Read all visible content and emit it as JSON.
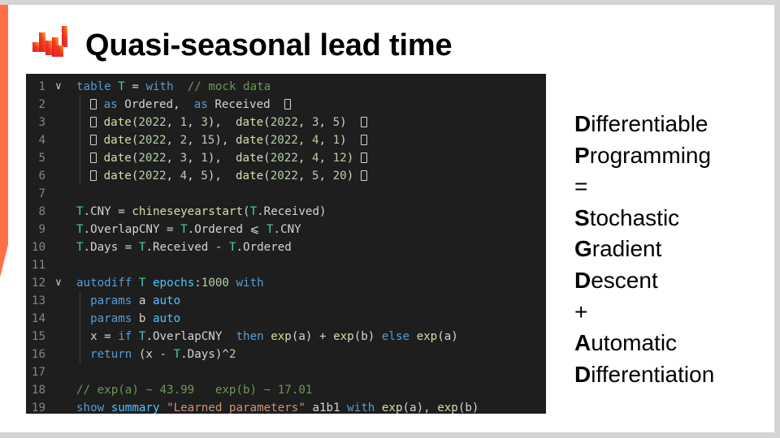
{
  "slide": {
    "title": "Quasi-seasonal lead time",
    "colors": {
      "accent_bar": "#ff7043",
      "logo_gradient": [
        "#d81b2c",
        "#f3391f",
        "#ffa726"
      ],
      "code_background": "#1e1e1e"
    }
  },
  "code": {
    "lines": [
      {
        "n": "1",
        "fold": true,
        "tokens": [
          [
            "kw",
            "table"
          ],
          [
            "pl",
            " "
          ],
          [
            "ty",
            "T"
          ],
          [
            "pl",
            " = "
          ],
          [
            "kw",
            "with"
          ],
          [
            "pl",
            "  "
          ],
          [
            "cm",
            "// mock data"
          ]
        ]
      },
      {
        "n": "2",
        "indent": true,
        "tokens": [
          [
            "pl",
            "  "
          ],
          [
            "box",
            ""
          ],
          [
            "pl",
            " "
          ],
          [
            "kw",
            "as"
          ],
          [
            "pl",
            " Ordered,  "
          ],
          [
            "kw",
            "as"
          ],
          [
            "pl",
            " Received  "
          ],
          [
            "box",
            ""
          ]
        ]
      },
      {
        "n": "3",
        "indent": true,
        "tokens": [
          [
            "pl",
            "  "
          ],
          [
            "box",
            ""
          ],
          [
            "pl",
            " "
          ],
          [
            "fn",
            "date"
          ],
          [
            "pl",
            "("
          ],
          [
            "num",
            "2022"
          ],
          [
            "pl",
            ", "
          ],
          [
            "num",
            "1"
          ],
          [
            "pl",
            ", "
          ],
          [
            "num",
            "3"
          ],
          [
            "pl",
            "),  "
          ],
          [
            "fn",
            "date"
          ],
          [
            "pl",
            "("
          ],
          [
            "num",
            "2022"
          ],
          [
            "pl",
            ", "
          ],
          [
            "num",
            "3"
          ],
          [
            "pl",
            ", "
          ],
          [
            "num",
            "5"
          ],
          [
            "pl",
            ")  "
          ],
          [
            "box",
            ""
          ]
        ]
      },
      {
        "n": "4",
        "indent": true,
        "tokens": [
          [
            "pl",
            "  "
          ],
          [
            "box",
            ""
          ],
          [
            "pl",
            " "
          ],
          [
            "fn",
            "date"
          ],
          [
            "pl",
            "("
          ],
          [
            "num",
            "2022"
          ],
          [
            "pl",
            ", "
          ],
          [
            "num",
            "2"
          ],
          [
            "pl",
            ", "
          ],
          [
            "num",
            "15"
          ],
          [
            "pl",
            "), "
          ],
          [
            "fn",
            "date"
          ],
          [
            "pl",
            "("
          ],
          [
            "num",
            "2022"
          ],
          [
            "pl",
            ", "
          ],
          [
            "num",
            "4"
          ],
          [
            "pl",
            ", "
          ],
          [
            "num",
            "1"
          ],
          [
            "pl",
            ")  "
          ],
          [
            "box",
            ""
          ]
        ]
      },
      {
        "n": "5",
        "indent": true,
        "tokens": [
          [
            "pl",
            "  "
          ],
          [
            "box",
            ""
          ],
          [
            "pl",
            " "
          ],
          [
            "fn",
            "date"
          ],
          [
            "pl",
            "("
          ],
          [
            "num",
            "2022"
          ],
          [
            "pl",
            ", "
          ],
          [
            "num",
            "3"
          ],
          [
            "pl",
            ", "
          ],
          [
            "num",
            "1"
          ],
          [
            "pl",
            "),  "
          ],
          [
            "fn",
            "date"
          ],
          [
            "pl",
            "("
          ],
          [
            "num",
            "2022"
          ],
          [
            "pl",
            ", "
          ],
          [
            "num",
            "4"
          ],
          [
            "pl",
            ", "
          ],
          [
            "num",
            "12"
          ],
          [
            "pl",
            ") "
          ],
          [
            "box",
            ""
          ]
        ]
      },
      {
        "n": "6",
        "indent": true,
        "tokens": [
          [
            "pl",
            "  "
          ],
          [
            "box",
            ""
          ],
          [
            "pl",
            " "
          ],
          [
            "fn",
            "date"
          ],
          [
            "pl",
            "("
          ],
          [
            "num",
            "2022"
          ],
          [
            "pl",
            ", "
          ],
          [
            "num",
            "4"
          ],
          [
            "pl",
            ", "
          ],
          [
            "num",
            "5"
          ],
          [
            "pl",
            "),  "
          ],
          [
            "fn",
            "date"
          ],
          [
            "pl",
            "("
          ],
          [
            "num",
            "2022"
          ],
          [
            "pl",
            ", "
          ],
          [
            "num",
            "5"
          ],
          [
            "pl",
            ", "
          ],
          [
            "num",
            "20"
          ],
          [
            "pl",
            ") "
          ],
          [
            "box",
            ""
          ]
        ]
      },
      {
        "n": "7",
        "tokens": []
      },
      {
        "n": "8",
        "tokens": [
          [
            "ty",
            "T"
          ],
          [
            "pl",
            ".CNY = "
          ],
          [
            "fn",
            "chineseyearstart"
          ],
          [
            "pl",
            "("
          ],
          [
            "ty",
            "T"
          ],
          [
            "pl",
            ".Received)"
          ]
        ]
      },
      {
        "n": "9",
        "tokens": [
          [
            "ty",
            "T"
          ],
          [
            "pl",
            ".OverlapCNY = "
          ],
          [
            "ty",
            "T"
          ],
          [
            "pl",
            ".Ordered ⩽ "
          ],
          [
            "ty",
            "T"
          ],
          [
            "pl",
            ".CNY"
          ]
        ]
      },
      {
        "n": "10",
        "tokens": [
          [
            "ty",
            "T"
          ],
          [
            "pl",
            ".Days = "
          ],
          [
            "ty",
            "T"
          ],
          [
            "pl",
            ".Received - "
          ],
          [
            "ty",
            "T"
          ],
          [
            "pl",
            ".Ordered"
          ]
        ]
      },
      {
        "n": "11",
        "tokens": []
      },
      {
        "n": "12",
        "fold": true,
        "tokens": [
          [
            "kw",
            "autodiff"
          ],
          [
            "pl",
            " "
          ],
          [
            "ty",
            "T"
          ],
          [
            "pl",
            " "
          ],
          [
            "kw2",
            "epochs"
          ],
          [
            "pl",
            ":"
          ],
          [
            "num",
            "1000"
          ],
          [
            "pl",
            " "
          ],
          [
            "kw",
            "with"
          ]
        ]
      },
      {
        "n": "13",
        "indent": true,
        "tokens": [
          [
            "pl",
            "  "
          ],
          [
            "kw",
            "params"
          ],
          [
            "pl",
            " a "
          ],
          [
            "kw2",
            "auto"
          ]
        ]
      },
      {
        "n": "14",
        "indent": true,
        "tokens": [
          [
            "pl",
            "  "
          ],
          [
            "kw",
            "params"
          ],
          [
            "pl",
            " b "
          ],
          [
            "kw2",
            "auto"
          ]
        ]
      },
      {
        "n": "15",
        "indent": true,
        "tokens": [
          [
            "pl",
            "  x = "
          ],
          [
            "kw",
            "if"
          ],
          [
            "pl",
            " "
          ],
          [
            "ty",
            "T"
          ],
          [
            "pl",
            ".OverlapCNY  "
          ],
          [
            "kw",
            "then"
          ],
          [
            "pl",
            " "
          ],
          [
            "fn",
            "exp"
          ],
          [
            "pl",
            "(a) + "
          ],
          [
            "fn",
            "exp"
          ],
          [
            "pl",
            "(b) "
          ],
          [
            "kw",
            "else"
          ],
          [
            "pl",
            " "
          ],
          [
            "fn",
            "exp"
          ],
          [
            "pl",
            "(a)"
          ]
        ]
      },
      {
        "n": "16",
        "indent": true,
        "tokens": [
          [
            "pl",
            "  "
          ],
          [
            "kw",
            "return"
          ],
          [
            "pl",
            " (x - "
          ],
          [
            "ty",
            "T"
          ],
          [
            "pl",
            ".Days)^"
          ],
          [
            "num",
            "2"
          ]
        ]
      },
      {
        "n": "17",
        "tokens": []
      },
      {
        "n": "18",
        "tokens": [
          [
            "cm",
            "// exp(a) ~ 43.99   exp(b) ~ 17.01"
          ]
        ]
      },
      {
        "n": "19",
        "tokens": [
          [
            "kw",
            "show"
          ],
          [
            "pl",
            " "
          ],
          [
            "kw2",
            "summary"
          ],
          [
            "pl",
            " "
          ],
          [
            "str",
            "\"Learned parameters\""
          ],
          [
            "pl",
            " a1b1 "
          ],
          [
            "kw",
            "with"
          ],
          [
            "pl",
            " "
          ],
          [
            "fn",
            "exp"
          ],
          [
            "pl",
            "(a), "
          ],
          [
            "fn",
            "exp"
          ],
          [
            "pl",
            "(b)"
          ]
        ]
      }
    ]
  },
  "side_text": [
    {
      "initial": "D",
      "rest": "ifferentiable"
    },
    {
      "initial": "P",
      "rest": "rogramming"
    },
    {
      "initial": "",
      "rest": "="
    },
    {
      "initial": "S",
      "rest": "tochastic"
    },
    {
      "initial": "G",
      "rest": "radient"
    },
    {
      "initial": "D",
      "rest": "escent"
    },
    {
      "initial": "",
      "rest": "+"
    },
    {
      "initial": "A",
      "rest": "utomatic"
    },
    {
      "initial": "D",
      "rest": "ifferentiation"
    }
  ]
}
